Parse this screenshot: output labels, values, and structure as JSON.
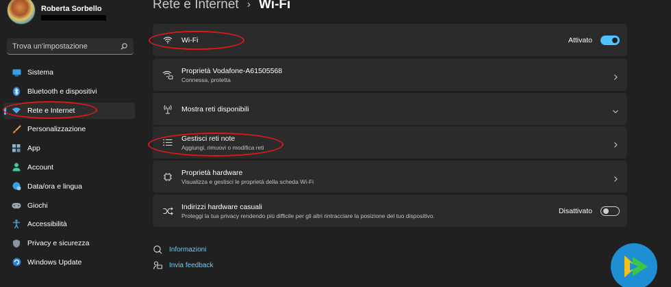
{
  "profile": {
    "name": "Roberta Sorbello"
  },
  "search": {
    "placeholder": "Trova un'impostazione"
  },
  "nav": [
    {
      "label": "Sistema",
      "icon": "monitor-icon",
      "active": false
    },
    {
      "label": "Bluetooth e dispositivi",
      "icon": "bluetooth-icon",
      "active": false
    },
    {
      "label": "Rete e Internet",
      "icon": "network-icon",
      "active": true
    },
    {
      "label": "Personalizzazione",
      "icon": "brush-icon",
      "active": false
    },
    {
      "label": "App",
      "icon": "apps-icon",
      "active": false
    },
    {
      "label": "Account",
      "icon": "person-icon",
      "active": false
    },
    {
      "label": "Data/ora e lingua",
      "icon": "globe-clock-icon",
      "active": false
    },
    {
      "label": "Giochi",
      "icon": "gamepad-icon",
      "active": false
    },
    {
      "label": "Accessibilità",
      "icon": "accessibility-icon",
      "active": false
    },
    {
      "label": "Privacy e sicurezza",
      "icon": "shield-icon",
      "active": false
    },
    {
      "label": "Windows Update",
      "icon": "update-icon",
      "active": false
    }
  ],
  "breadcrumb": {
    "parent": "Rete e Internet",
    "separator": "›",
    "current": "Wi-Fi"
  },
  "cards": {
    "wifi": {
      "title": "Wi-Fi",
      "toggle_label": "Attivato",
      "toggle_on": true
    },
    "properties": {
      "title": "Proprietà Vodafone-A61505568",
      "subtitle": "Connessa, protetta"
    },
    "available": {
      "title": "Mostra reti disponibili"
    },
    "known": {
      "title": "Gestisci reti note",
      "subtitle": "Aggiungi, rimuovi o modifica reti"
    },
    "hardware": {
      "title": "Proprietà hardware",
      "subtitle": "Visualizza e gestisci le proprietà della scheda Wi-Fi"
    },
    "random": {
      "title": "Indirizzi hardware casuali",
      "subtitle": "Proteggi la tua privacy rendendo più difficile per gli altri rintracciare la posizione del tuo dispositivo.",
      "toggle_label": "Disattivato",
      "toggle_on": false
    }
  },
  "links": {
    "info": "Informazioni",
    "feedback": "Invia feedback"
  },
  "colors": {
    "accent": "#4cc2ff",
    "annotation": "#e01818",
    "background": "#202020",
    "card": "#2b2b2b"
  }
}
